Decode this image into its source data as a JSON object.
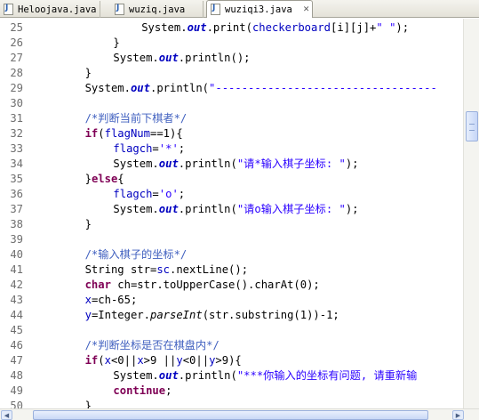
{
  "tabs": [
    {
      "label": "Heloojava.java"
    },
    {
      "label": "wuziq.java"
    },
    {
      "label": "wuziqi3.java",
      "close": "✕"
    }
  ],
  "colors": {
    "keyword": "#7f0055",
    "static_field": "#0000c0",
    "string": "#2a00ff",
    "comment": "#3f5fbf",
    "line_number": "#6f6f6f"
  },
  "icons": {
    "tab_file": "java-file-icon",
    "tab_close": "close-icon",
    "scroll_left": "left-arrow-icon",
    "scroll_right": "right-arrow-icon"
  },
  "scrollbar": {
    "left_arrow": "◀",
    "right_arrow": "▶"
  },
  "code": {
    "lines": [
      {
        "n": "25",
        "indent": 16,
        "tokens": [
          [
            "p",
            "System."
          ],
          [
            "fld",
            "out"
          ],
          [
            "p",
            "."
          ],
          [
            "p",
            "print("
          ],
          [
            "var",
            "checkerboard"
          ],
          [
            "p",
            "[i][j]+"
          ],
          [
            "str",
            "\" \""
          ],
          [
            "p",
            ");"
          ]
        ]
      },
      {
        "n": "26",
        "indent": 12,
        "tokens": [
          [
            "p",
            "}"
          ]
        ]
      },
      {
        "n": "27",
        "indent": 12,
        "tokens": [
          [
            "p",
            "System."
          ],
          [
            "fld",
            "out"
          ],
          [
            "p",
            ".println();"
          ]
        ]
      },
      {
        "n": "28",
        "indent": 8,
        "tokens": [
          [
            "p",
            "}"
          ]
        ]
      },
      {
        "n": "29",
        "indent": 8,
        "tokens": [
          [
            "p",
            "System."
          ],
          [
            "fld",
            "out"
          ],
          [
            "p",
            ".println("
          ],
          [
            "str",
            "\"----------------------------------"
          ]
        ]
      },
      {
        "n": "30",
        "indent": 8,
        "tokens": []
      },
      {
        "n": "31",
        "indent": 8,
        "tokens": [
          [
            "cmt",
            "/*判断当前下棋者*/"
          ]
        ]
      },
      {
        "n": "32",
        "indent": 8,
        "tokens": [
          [
            "kw",
            "if"
          ],
          [
            "p",
            "("
          ],
          [
            "var",
            "flagNum"
          ],
          [
            "p",
            "==1){"
          ]
        ]
      },
      {
        "n": "33",
        "indent": 12,
        "tokens": [
          [
            "var",
            "flagch"
          ],
          [
            "p",
            "="
          ],
          [
            "str",
            "'*'"
          ],
          [
            "p",
            ";"
          ]
        ]
      },
      {
        "n": "34",
        "indent": 12,
        "tokens": [
          [
            "p",
            "System."
          ],
          [
            "fld",
            "out"
          ],
          [
            "p",
            ".println("
          ],
          [
            "str",
            "\"请*输入棋子坐标: \""
          ],
          [
            "p",
            ");"
          ]
        ]
      },
      {
        "n": "35",
        "indent": 8,
        "tokens": [
          [
            "p",
            "}"
          ],
          [
            "kw",
            "else"
          ],
          [
            "p",
            "{"
          ]
        ]
      },
      {
        "n": "36",
        "indent": 12,
        "tokens": [
          [
            "var",
            "flagch"
          ],
          [
            "p",
            "="
          ],
          [
            "str",
            "'o'"
          ],
          [
            "p",
            ";"
          ]
        ]
      },
      {
        "n": "37",
        "indent": 12,
        "tokens": [
          [
            "p",
            "System."
          ],
          [
            "fld",
            "out"
          ],
          [
            "p",
            ".println("
          ],
          [
            "str",
            "\"请o输入棋子坐标: \""
          ],
          [
            "p",
            ");"
          ]
        ]
      },
      {
        "n": "38",
        "indent": 8,
        "tokens": [
          [
            "p",
            "}"
          ]
        ]
      },
      {
        "n": "39",
        "indent": 8,
        "tokens": []
      },
      {
        "n": "40",
        "indent": 8,
        "tokens": [
          [
            "cmt",
            "/*输入棋子的坐标*/"
          ]
        ]
      },
      {
        "n": "41",
        "indent": 8,
        "tokens": [
          [
            "p",
            "String str="
          ],
          [
            "var",
            "sc"
          ],
          [
            "p",
            ".nextLine();"
          ]
        ]
      },
      {
        "n": "42",
        "indent": 8,
        "tokens": [
          [
            "kw",
            "char"
          ],
          [
            "p",
            " ch=str.toUpperCase().charAt(0);"
          ]
        ]
      },
      {
        "n": "43",
        "indent": 8,
        "tokens": [
          [
            "var",
            "x"
          ],
          [
            "p",
            "=ch-65;"
          ]
        ]
      },
      {
        "n": "44",
        "indent": 8,
        "tokens": [
          [
            "var",
            "y"
          ],
          [
            "p",
            "=Integer."
          ],
          [
            "mth",
            "parseInt"
          ],
          [
            "p",
            "(str.substring(1))-1;"
          ]
        ]
      },
      {
        "n": "45",
        "indent": 8,
        "tokens": []
      },
      {
        "n": "46",
        "indent": 8,
        "tokens": [
          [
            "cmt",
            "/*判断坐标是否在棋盘内*/"
          ]
        ]
      },
      {
        "n": "47",
        "indent": 8,
        "tokens": [
          [
            "kw",
            "if"
          ],
          [
            "p",
            "("
          ],
          [
            "var",
            "x"
          ],
          [
            "p",
            "<0||"
          ],
          [
            "var",
            "x"
          ],
          [
            "p",
            ">9 ||"
          ],
          [
            "var",
            "y"
          ],
          [
            "p",
            "<0||"
          ],
          [
            "var",
            "y"
          ],
          [
            "p",
            ">9){"
          ]
        ]
      },
      {
        "n": "48",
        "indent": 12,
        "tokens": [
          [
            "p",
            "System."
          ],
          [
            "fld",
            "out"
          ],
          [
            "p",
            ".println("
          ],
          [
            "str",
            "\"***你输入的坐标有问题, 请重新输"
          ]
        ]
      },
      {
        "n": "49",
        "indent": 12,
        "tokens": [
          [
            "kw",
            "continue"
          ],
          [
            "p",
            ";"
          ]
        ]
      },
      {
        "n": "50",
        "indent": 8,
        "tokens": [
          [
            "p",
            "}"
          ]
        ]
      }
    ]
  }
}
